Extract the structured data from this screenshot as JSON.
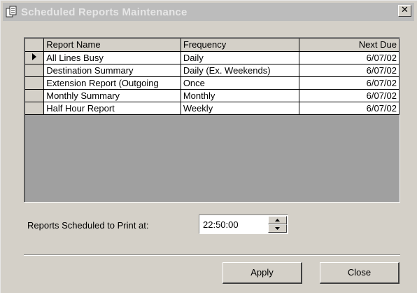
{
  "window": {
    "title": "Scheduled Reports Maintenance",
    "close_glyph": "✕"
  },
  "table": {
    "headers": {
      "name": "Report Name",
      "frequency": "Frequency",
      "next_due": "Next Due"
    },
    "rows": [
      {
        "selected": true,
        "name": "All Lines Busy",
        "frequency": "Daily",
        "next_due": "6/07/02"
      },
      {
        "selected": false,
        "name": "Destination Summary",
        "frequency": "Daily (Ex. Weekends)",
        "next_due": "6/07/02"
      },
      {
        "selected": false,
        "name": "Extension Report (Outgoing",
        "frequency": "Once",
        "next_due": "6/07/02"
      },
      {
        "selected": false,
        "name": "Monthly Summary",
        "frequency": "Monthly",
        "next_due": "6/07/02"
      },
      {
        "selected": false,
        "name": "Half Hour Report",
        "frequency": "Weekly",
        "next_due": "6/07/02"
      }
    ]
  },
  "schedule": {
    "label": "Reports Scheduled to Print at:",
    "time": "22:50:00"
  },
  "buttons": {
    "apply": "Apply",
    "close": "Close"
  },
  "icons": {
    "app": "report-document-icon",
    "row_indicator": "row-pointer-icon",
    "spin_up": "spin-up-icon",
    "spin_down": "spin-down-icon"
  }
}
